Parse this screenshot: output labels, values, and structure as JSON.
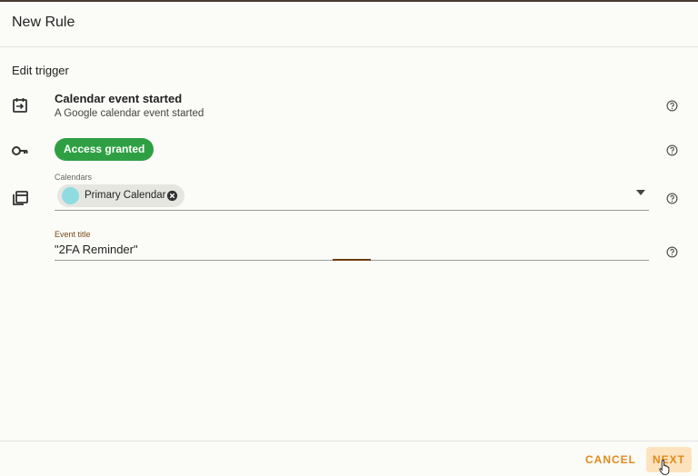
{
  "dialog": {
    "title": "New Rule"
  },
  "trigger": {
    "section_label": "Edit trigger",
    "name": "Calendar event started",
    "description": "A Google calendar event started",
    "access_label": "Access granted"
  },
  "calendars": {
    "label": "Calendars",
    "selected": [
      {
        "name": "Primary Calendar",
        "color": "#8fdbe0"
      }
    ]
  },
  "event_title": {
    "label": "Event title",
    "value": "\"2FA Reminder\""
  },
  "footer": {
    "cancel_label": "CANCEL",
    "next_label": "NEXT"
  },
  "colors": {
    "accent": "#e08a1e",
    "success": "#2ea043",
    "label_accent": "#7a4a1c"
  },
  "icons": {
    "trigger": "calendar-event-icon",
    "access": "key-icon",
    "calendars": "calendar-stack-icon",
    "help": "help-circle-icon"
  }
}
